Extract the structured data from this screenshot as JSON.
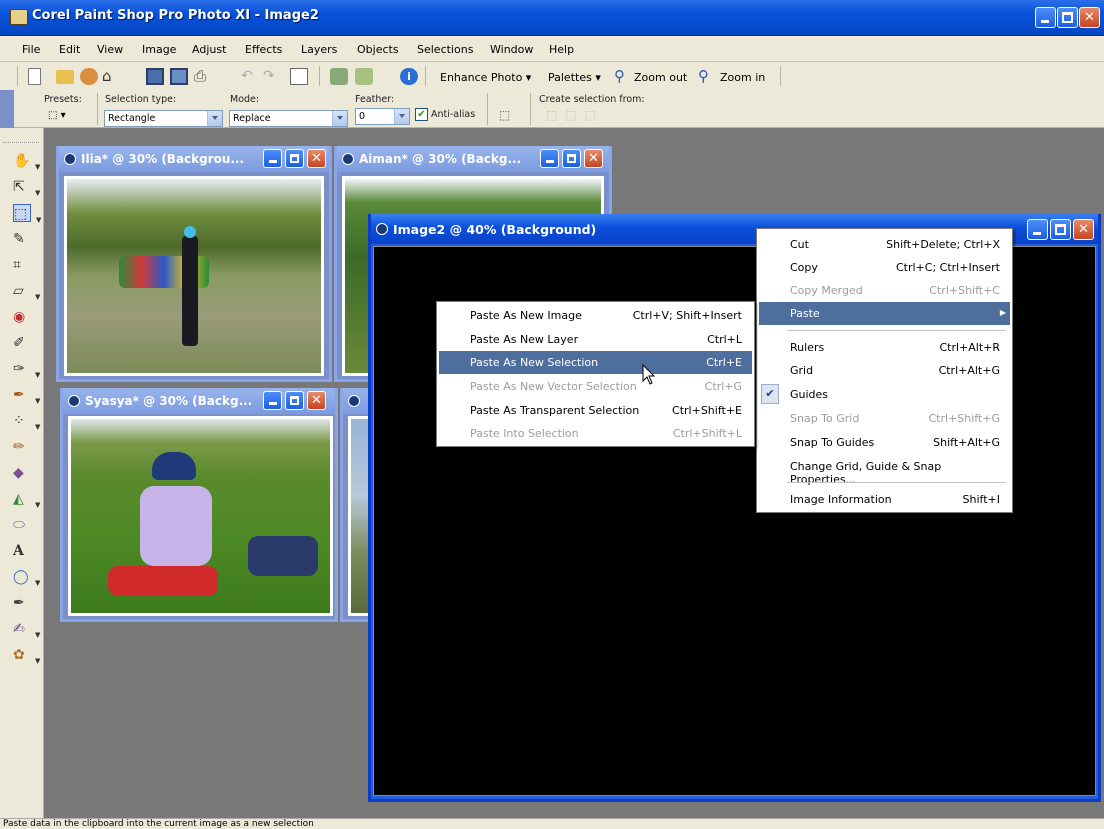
{
  "window": {
    "title": "Corel Paint Shop Pro Photo XI - Image2"
  },
  "menubar": [
    "File",
    "Edit",
    "View",
    "Image",
    "Adjust",
    "Effects",
    "Layers",
    "Objects",
    "Selections",
    "Window",
    "Help"
  ],
  "toolbar": {
    "enhance_photo": "Enhance Photo",
    "palettes": "Palettes",
    "zoom_out": "Zoom out",
    "zoom_in": "Zoom in"
  },
  "options": {
    "presets_label": "Presets:",
    "selection_type_label": "Selection type:",
    "selection_type_value": "Rectangle",
    "mode_label": "Mode:",
    "mode_value": "Replace",
    "feather_label": "Feather:",
    "feather_value": "0",
    "antialias_label": "Anti-alias",
    "antialias_checked": true,
    "create_from_label": "Create selection from:"
  },
  "documents": [
    {
      "title": "Ilia* @  30% (Backgrou..."
    },
    {
      "title": "Aiman* @  30% (Backg..."
    },
    {
      "title": "Syasya* @  30% (Backg..."
    },
    {
      "title": "Image2 @  40% (Background)"
    }
  ],
  "context_menu": {
    "items": [
      {
        "label": "Cut",
        "shortcut": "Shift+Delete; Ctrl+X",
        "disabled": false
      },
      {
        "label": "Copy",
        "shortcut": "Ctrl+C; Ctrl+Insert",
        "disabled": false
      },
      {
        "label": "Copy Merged",
        "shortcut": "Ctrl+Shift+C",
        "disabled": true
      },
      {
        "label": "Paste",
        "shortcut": "",
        "disabled": false,
        "highlighted": true,
        "submenu": true
      },
      {
        "label": "Rulers",
        "shortcut": "Ctrl+Alt+R",
        "disabled": false
      },
      {
        "label": "Grid",
        "shortcut": "Ctrl+Alt+G",
        "disabled": false
      },
      {
        "label": "Guides",
        "shortcut": "",
        "disabled": false,
        "checked": true
      },
      {
        "label": "Snap To Grid",
        "shortcut": "Ctrl+Shift+G",
        "disabled": true
      },
      {
        "label": "Snap To Guides",
        "shortcut": "Shift+Alt+G",
        "disabled": false
      },
      {
        "label": "Change Grid, Guide & Snap Properties...",
        "shortcut": "",
        "disabled": false
      },
      {
        "label": "Image Information",
        "shortcut": "Shift+I",
        "disabled": false
      }
    ]
  },
  "paste_submenu": {
    "items": [
      {
        "label": "Paste As New Image",
        "shortcut": "Ctrl+V; Shift+Insert",
        "disabled": false
      },
      {
        "label": "Paste As New Layer",
        "shortcut": "Ctrl+L",
        "disabled": false
      },
      {
        "label": "Paste As New Selection",
        "shortcut": "Ctrl+E",
        "disabled": false,
        "highlighted": true
      },
      {
        "label": "Paste As New Vector Selection",
        "shortcut": "Ctrl+G",
        "disabled": true
      },
      {
        "label": "Paste As Transparent Selection",
        "shortcut": "Ctrl+Shift+E",
        "disabled": false
      },
      {
        "label": "Paste Into Selection",
        "shortcut": "Ctrl+Shift+L",
        "disabled": true
      }
    ]
  },
  "status": {
    "text": "Paste data in the clipboard into the current image as a new selection"
  },
  "colors": {
    "title_blue": "#0852d8",
    "menu_highlight": "#4e6e9e",
    "chrome": "#ece9d8",
    "workspace": "#787878"
  }
}
